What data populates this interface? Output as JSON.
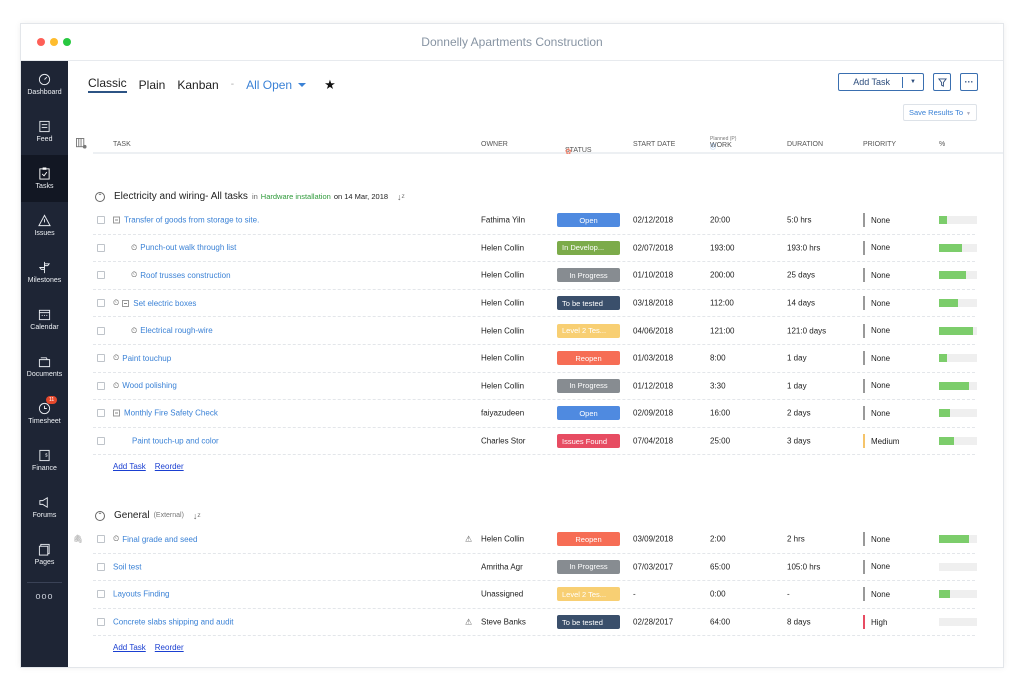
{
  "window": {
    "title": "Donnelly Apartments Construction",
    "traffic_lights": [
      "#fe5f57",
      "#febc2e",
      "#28c840"
    ]
  },
  "sidebar": {
    "items": [
      {
        "label": "Dashboard",
        "icon": "gauge-icon"
      },
      {
        "label": "Feed",
        "icon": "feed-icon"
      },
      {
        "label": "Tasks",
        "icon": "clipboard-check-icon",
        "active": true
      },
      {
        "label": "Issues",
        "icon": "warning-icon"
      },
      {
        "label": "Milestones",
        "icon": "signpost-icon"
      },
      {
        "label": "Calendar",
        "icon": "calendar-icon"
      },
      {
        "label": "Documents",
        "icon": "folder-icon"
      },
      {
        "label": "Timesheet",
        "icon": "clock-icon",
        "badge": "11"
      },
      {
        "label": "Finance",
        "icon": "invoice-icon"
      },
      {
        "label": "Forums",
        "icon": "megaphone-icon"
      },
      {
        "label": "Pages",
        "icon": "pages-icon"
      }
    ],
    "more": "ooo"
  },
  "toolbar": {
    "views": [
      "Classic",
      "Plain",
      "Kanban"
    ],
    "active_view": "Classic",
    "separator": "-",
    "filter": "All Open",
    "add_task": "Add Task",
    "save_results": "Save Results To"
  },
  "columns": {
    "task": "TASK",
    "owner": "OWNER",
    "status": "STATUS",
    "start_date": "START DATE",
    "work": "WORK",
    "work_sub": "Planned (P)",
    "duration": "DURATION",
    "priority": "PRIORITY",
    "percent": "%"
  },
  "status_colors": {
    "Open": "#4f8ae0",
    "In Develop...": "#7cab4a",
    "In Progress": "#878c91",
    "To be tested": "#3a4f6b",
    "Level 2 Tes...": "#f8cf73",
    "Reopen": "#f66d55",
    "Issues Found": "#e74c62"
  },
  "groups": [
    {
      "name": "Electricity and wiring- All tasks",
      "in_text": "in",
      "milestone": "Hardware installation",
      "on_text": "on 14 Mar, 2018",
      "tasks": [
        {
          "name": "Transfer of goods from storage to site.",
          "indent": 0,
          "expander": true,
          "timer": false,
          "timer_outside": false,
          "owner": "Fathima Yiln",
          "status": "Open",
          "start": "02/12/2018",
          "work": "20:00",
          "duration": "5:0 hrs",
          "priority": "None",
          "percent": 20
        },
        {
          "name": "Punch-out walk through list",
          "indent": 1,
          "expander": false,
          "timer": true,
          "owner": "Helen Collin",
          "status": "In Develop...",
          "start": "02/07/2018",
          "work": "193:00",
          "duration": "193:0 hrs",
          "priority": "None",
          "percent": 60
        },
        {
          "name": "Roof trusses construction",
          "indent": 1,
          "expander": false,
          "timer": true,
          "owner": "Helen Collin",
          "status": "In Progress",
          "start": "01/10/2018",
          "work": "200:00",
          "duration": "25 days",
          "priority": "None",
          "percent": 70
        },
        {
          "name": "Set electric boxes",
          "indent": 0,
          "expander": true,
          "timer_outside": true,
          "owner": "Helen Collin",
          "status": "To be tested",
          "start": "03/18/2018",
          "work": "112:00",
          "duration": "14 days",
          "priority": "None",
          "percent": 50
        },
        {
          "name": "Electrical rough-wire",
          "indent": 1,
          "expander": false,
          "timer": true,
          "owner": "Helen Collin",
          "status": "Level 2 Tes...",
          "start": "04/06/2018",
          "work": "121:00",
          "duration": "121:0 days",
          "priority": "None",
          "percent": 90
        },
        {
          "name": "Paint touchup",
          "indent": 0,
          "expander": false,
          "timer": true,
          "owner": "Helen Collin",
          "status": "Reopen",
          "start": "01/03/2018",
          "work": "8:00",
          "duration": "1 day",
          "priority": "None",
          "percent": 20
        },
        {
          "name": "Wood polishing",
          "indent": 0,
          "expander": false,
          "timer": true,
          "owner": "Helen Collin",
          "status": "In Progress",
          "start": "01/12/2018",
          "work": "3:30",
          "duration": "1 day",
          "priority": "None",
          "percent": 80
        },
        {
          "name": "Monthly Fire Safety Check",
          "indent": 0,
          "expander": true,
          "timer": false,
          "owner": "faiyazudeen",
          "status": "Open",
          "start": "02/09/2018",
          "work": "16:00",
          "duration": "2 days",
          "priority": "None",
          "percent": 30
        },
        {
          "name": "Paint touch-up and color",
          "indent": 2,
          "expander": false,
          "timer": false,
          "owner": "Charles Stor",
          "status": "Issues Found",
          "start": "07/04/2018",
          "work": "25:00",
          "duration": "3 days",
          "priority": "Medium",
          "percent": 40
        }
      ],
      "add_task": "Add Task",
      "reorder": "Reorder"
    },
    {
      "name": "General",
      "external": "(External)",
      "tasks": [
        {
          "name": "Final grade and seed",
          "indent": 0,
          "expander": false,
          "timer": true,
          "attachment": true,
          "warning": true,
          "owner": "Helen Collin",
          "status": "Reopen",
          "start": "03/09/2018",
          "work": "2:00",
          "duration": "2 hrs",
          "priority": "None",
          "percent": 80
        },
        {
          "name": "Soil test",
          "indent": 0,
          "expander": false,
          "timer": false,
          "owner": "Amritha Agr",
          "status": "In Progress",
          "start": "07/03/2017",
          "work": "65:00",
          "duration": "105:0 hrs",
          "priority": "None",
          "percent": 0
        },
        {
          "name": "Layouts Finding",
          "indent": 0,
          "expander": false,
          "timer": false,
          "owner": "Unassigned",
          "status": "Level 2 Tes...",
          "start": "-",
          "work": "0:00",
          "duration": "-",
          "priority": "None",
          "percent": 30
        },
        {
          "name": "Concrete slabs shipping and audit",
          "indent": 0,
          "expander": false,
          "timer": false,
          "warning": true,
          "owner": "Steve Banks",
          "status": "To be tested",
          "start": "02/28/2017",
          "work": "64:00",
          "duration": "8 days",
          "priority": "High",
          "percent": 0
        }
      ],
      "add_task": "Add Task",
      "reorder": "Reorder"
    }
  ],
  "priority_colors": {
    "None": "#999999",
    "Medium": "#f5c46a",
    "High": "#e74c62"
  }
}
